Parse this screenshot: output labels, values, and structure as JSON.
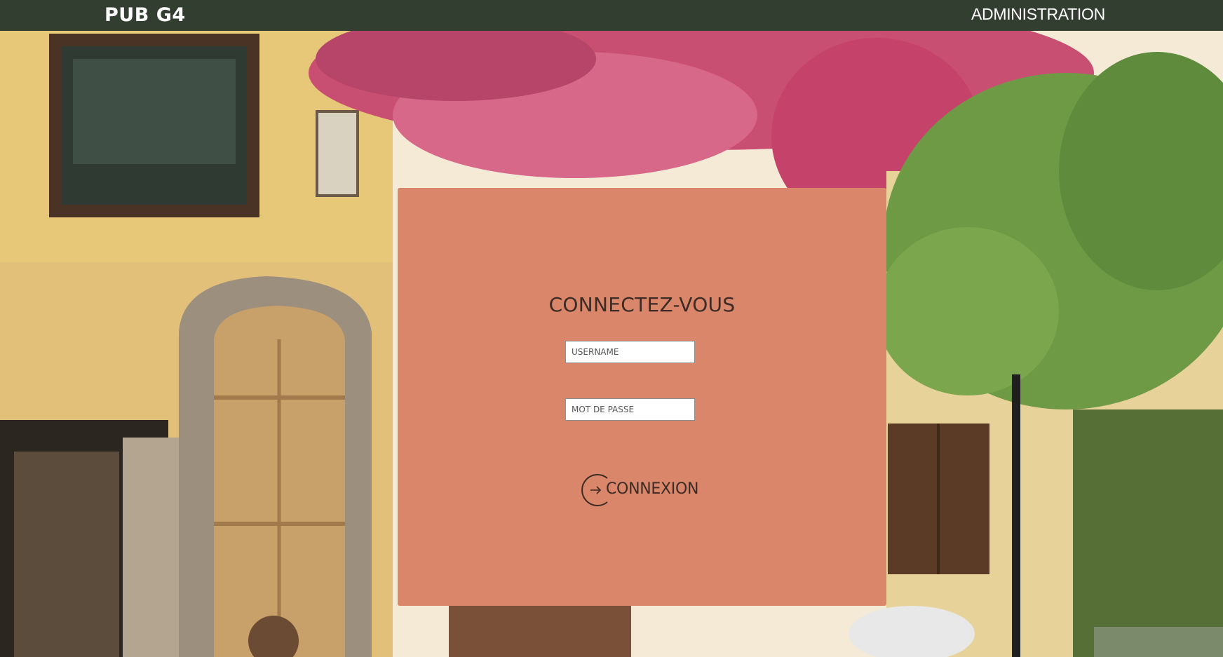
{
  "header": {
    "brand": "PUB G4",
    "admin_link": "ADMINISTRATION"
  },
  "login": {
    "title": "CONNECTEZ-VOUS",
    "username_placeholder": "USERNAME",
    "password_placeholder": "MOT DE PASSE",
    "submit_label": "CONNEXION",
    "submit_icon": "arrow-right-circle-icon"
  },
  "colors": {
    "nav_bg": "#323f30",
    "panel_bg": "#d9866a",
    "text_dark": "#3d2b25"
  }
}
